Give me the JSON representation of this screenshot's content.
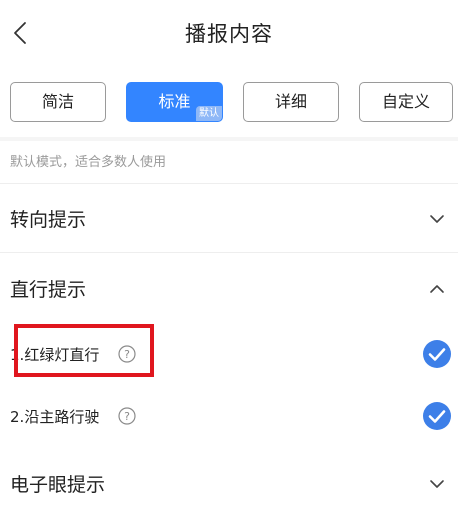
{
  "header": {
    "title": "播报内容",
    "back_icon": "chevron-left-icon"
  },
  "tabs": [
    {
      "label": "简洁",
      "active": false
    },
    {
      "label": "标准",
      "active": true,
      "badge": "默认"
    },
    {
      "label": "详细",
      "active": false
    },
    {
      "label": "自定义",
      "active": false
    }
  ],
  "mode_description": "默认模式，适合多数人使用",
  "sections": {
    "turn": {
      "title": "转向提示",
      "expanded": false,
      "icon": "chevron-down-icon"
    },
    "straight": {
      "title": "直行提示",
      "expanded": true,
      "icon": "chevron-up-icon",
      "items": [
        {
          "number": "1.",
          "label": "红绿灯直行",
          "checked": true,
          "help_icon": "question-circle-icon"
        },
        {
          "number": "2.",
          "label": "沿主路行驶",
          "checked": true,
          "help_icon": "question-circle-icon"
        }
      ]
    },
    "camera": {
      "title": "电子眼提示",
      "expanded": false,
      "icon": "chevron-down-icon"
    }
  },
  "colors": {
    "accent": "#3385ff",
    "check": "#3d7fe8",
    "highlight": "#e0161e",
    "muted_text": "#9a9a9a"
  }
}
